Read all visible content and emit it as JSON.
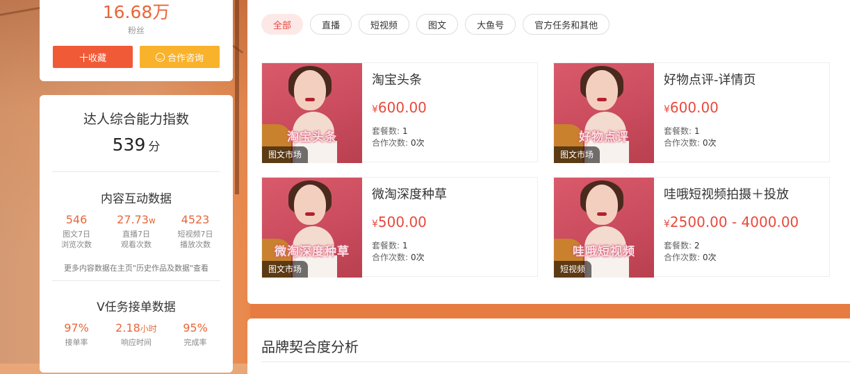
{
  "profile": {
    "fans_count": "16.68万",
    "fans_label": "粉丝",
    "favorite_button": "十收藏",
    "consult_button": "合作咨询"
  },
  "ability": {
    "title": "达人综合能力指数",
    "score": "539",
    "score_unit": "分"
  },
  "content_stats": {
    "title": "内容互动数据",
    "items": [
      {
        "value": "546",
        "unit": "",
        "label1": "图文7日",
        "label2": "浏览次数"
      },
      {
        "value": "27.73",
        "unit": "w",
        "label1": "直播7日",
        "label2": "观看次数"
      },
      {
        "value": "4523",
        "unit": "",
        "label1": "短视频7日",
        "label2": "播放次数"
      }
    ],
    "note": "更多内容数据在主页\"历史作品及数据\"查看"
  },
  "task_stats": {
    "title": "V任务接单数据",
    "items": [
      {
        "value": "97%",
        "unit": "",
        "label": "接单率"
      },
      {
        "value": "2.18",
        "unit": "小时",
        "label": "响应时间"
      },
      {
        "value": "95%",
        "unit": "",
        "label": "完成率"
      }
    ]
  },
  "tabs": [
    {
      "label": "全部",
      "active": true
    },
    {
      "label": "直播",
      "active": false
    },
    {
      "label": "短视频",
      "active": false
    },
    {
      "label": "图文",
      "active": false
    },
    {
      "label": "大鱼号",
      "active": false
    },
    {
      "label": "官方任务和其他",
      "active": false
    }
  ],
  "services": [
    {
      "title": "淘宝头条",
      "currency": "¥",
      "price": "600.00",
      "thumb_text": "淘宝头条",
      "tag": "图文市场",
      "set_label": "套餐数:",
      "set_count": "1",
      "coop_label": "合作次数:",
      "coop_count": "0次"
    },
    {
      "title": "好物点评-详情页",
      "currency": "¥",
      "price": "600.00",
      "thumb_text": "好物点评",
      "tag": "图文市场",
      "set_label": "套餐数:",
      "set_count": "1",
      "coop_label": "合作次数:",
      "coop_count": "0次"
    },
    {
      "title": "微淘深度种草",
      "currency": "¥",
      "price": "500.00",
      "thumb_text": "微淘深度种草",
      "tag": "图文市场",
      "set_label": "套餐数:",
      "set_count": "1",
      "coop_label": "合作次数:",
      "coop_count": "0次"
    },
    {
      "title": "哇哦短视频拍摄＋投放",
      "currency": "¥",
      "price": "2500.00 - 4000.00",
      "thumb_text": "哇哦短视频",
      "tag": "短视频",
      "set_label": "套餐数:",
      "set_count": "2",
      "coop_label": "合作次数:",
      "coop_count": "0次"
    }
  ],
  "brand": {
    "title": "品牌契合度分析"
  },
  "colors": {
    "accent": "#e8493c",
    "stat_value": "#e8663a",
    "favorite_button_bg": "#f05a36",
    "consult_button_bg": "#f9b22b",
    "active_tab_bg": "#fde8e8"
  }
}
